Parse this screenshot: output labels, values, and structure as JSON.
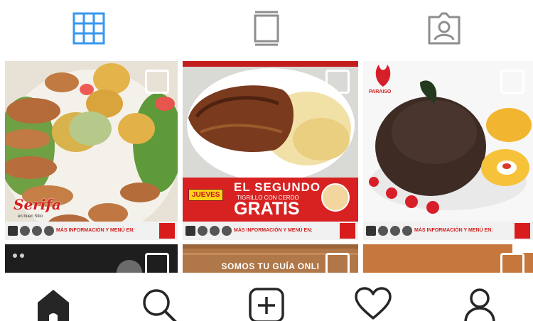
{
  "tabs": [
    {
      "name": "grid-view",
      "icon": "grid-icon",
      "active": true
    },
    {
      "name": "feed-view",
      "icon": "list-icon",
      "active": false
    },
    {
      "name": "tagged-view",
      "icon": "tagged-person-icon",
      "active": false
    }
  ],
  "colors": {
    "active_tab": "#3897f0",
    "inactive_icon": "#8e8e8e",
    "nav_icon": "#262626",
    "banner_red": "#d82222"
  },
  "posts": {
    "post1": {
      "brand": "Serifa",
      "subtitle": "en buen Sitio",
      "footer_text": "MÁS INFORMACIÓN Y MENÚ EN:"
    },
    "post2": {
      "tag": "JUEVES",
      "headline": "EL SEGUNDO",
      "subline": "TIGRILLO CON CERDO",
      "offer": "GRATIS",
      "footer_text": "MÁS INFORMACIÓN Y MENÚ EN:"
    },
    "post3": {
      "brand": "PARAISO",
      "footer_text": "MÁS INFORMACIÓN Y MENÚ EN:"
    },
    "post5": {
      "text": "SOMOS TU GUÍA ONLI"
    }
  },
  "bottom_nav": [
    {
      "name": "home",
      "icon": "home-icon",
      "active": true
    },
    {
      "name": "search",
      "icon": "search-icon",
      "active": false
    },
    {
      "name": "new-post",
      "icon": "add-post-icon",
      "active": false
    },
    {
      "name": "activity",
      "icon": "heart-icon",
      "active": false
    },
    {
      "name": "profile",
      "icon": "profile-icon",
      "active": false
    }
  ]
}
